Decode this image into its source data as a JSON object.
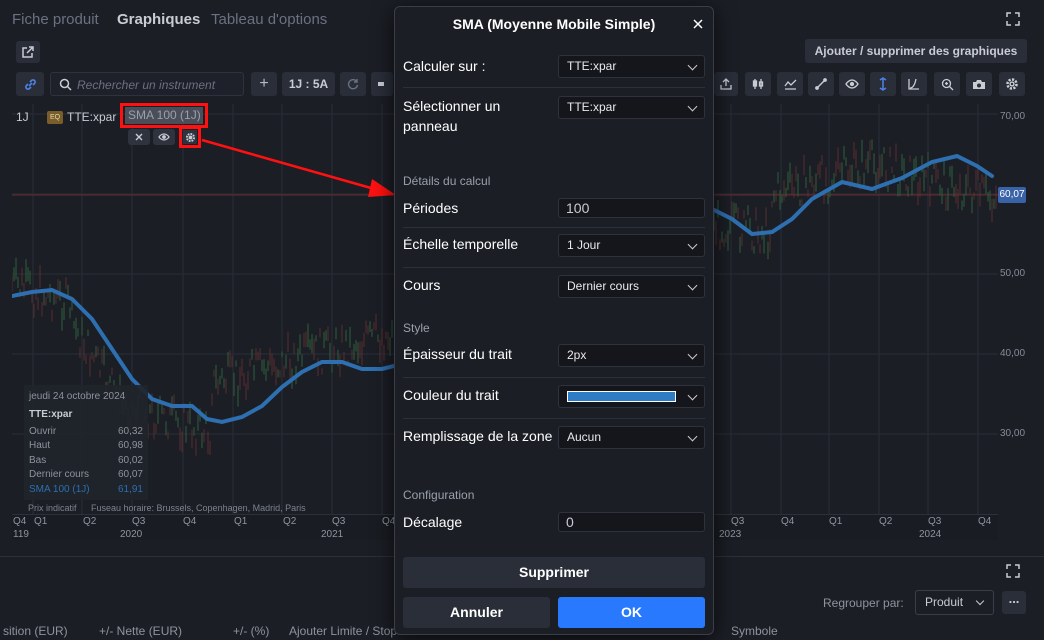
{
  "tabs": [
    "Fiche produit",
    "Graphiques",
    "Tableau d'options"
  ],
  "toolbar": {
    "add_remove_charts": "Ajouter / supprimer des graphiques",
    "search_placeholder": "Rechercher un instrument",
    "plus": "+",
    "period": "1J : 5A"
  },
  "legend": {
    "interval": "1J",
    "ticker_badge": "EQ",
    "ticker": "TTE:xpar",
    "indicator": "SMA 100 (1J)"
  },
  "y_axis": {
    "labels": [
      "70,00",
      "60,00",
      "50,00",
      "40,00",
      "30,00"
    ],
    "current_price": "60,07"
  },
  "x_axis": {
    "quarters": [
      "Q4",
      "Q1",
      "Q2",
      "Q3",
      "Q4",
      "Q1",
      "Q2",
      "Q3",
      "Q4",
      "Q1",
      "Q2",
      "Q3",
      "Q4",
      "Q1",
      "Q2",
      "Q3",
      "Q4"
    ],
    "years": [
      "119",
      "2020",
      "2021",
      "2023",
      "2024"
    ]
  },
  "tooltip": {
    "date": "jeudi 24 octobre 2024",
    "ticker": "TTE:xpar",
    "rows": [
      {
        "label": "Ouvrir",
        "value": "60,32"
      },
      {
        "label": "Haut",
        "value": "60,98"
      },
      {
        "label": "Bas",
        "value": "60,02"
      },
      {
        "label": "Dernier cours",
        "value": "60,07"
      },
      {
        "label": "SMA 100 (1J)",
        "value": "61,91"
      }
    ]
  },
  "footnote": {
    "indicative": "Prix indicatif",
    "timezone": "Fuseau horaire: Brussels, Copenhagen, Madrid, Paris"
  },
  "modal": {
    "title": "SMA (Moyenne Mobile Simple)",
    "calc_on_label": "Calculer sur :",
    "calc_on_value": "TTE:xpar",
    "panel_label": "Sélectionner un panneau",
    "panel_value": "TTE:xpar",
    "calc_details": "Détails du calcul",
    "periods_label": "Périodes",
    "periods_value": "100",
    "timescale_label": "Échelle temporelle",
    "timescale_value": "1 Jour",
    "price_label": "Cours",
    "price_value": "Dernier cours",
    "style_section": "Style",
    "thickness_label": "Épaisseur du trait",
    "thickness_value": "2px",
    "color_label": "Couleur du trait",
    "line_color": "#2d7cc4",
    "fill_label": "Remplissage de la zone",
    "fill_value": "Aucun",
    "config_section": "Configuration",
    "offset_label": "Décalage",
    "offset_value": "0",
    "delete_button": "Supprimer",
    "cancel_button": "Annuler",
    "ok_button": "OK"
  },
  "bottom": {
    "group_by_label": "Regrouper par:",
    "group_by_value": "Produit",
    "more": "...",
    "columns": [
      "sition (EUR)",
      "+/- Nette (EUR)",
      "+/- (%)",
      "Ajouter Limite / Stop",
      "Symbole"
    ]
  },
  "colors": {
    "accent": "#2979ff",
    "sma": "#2d6fb0",
    "annotation": "#ff1111",
    "price_label_bg": "#3a62a8"
  }
}
